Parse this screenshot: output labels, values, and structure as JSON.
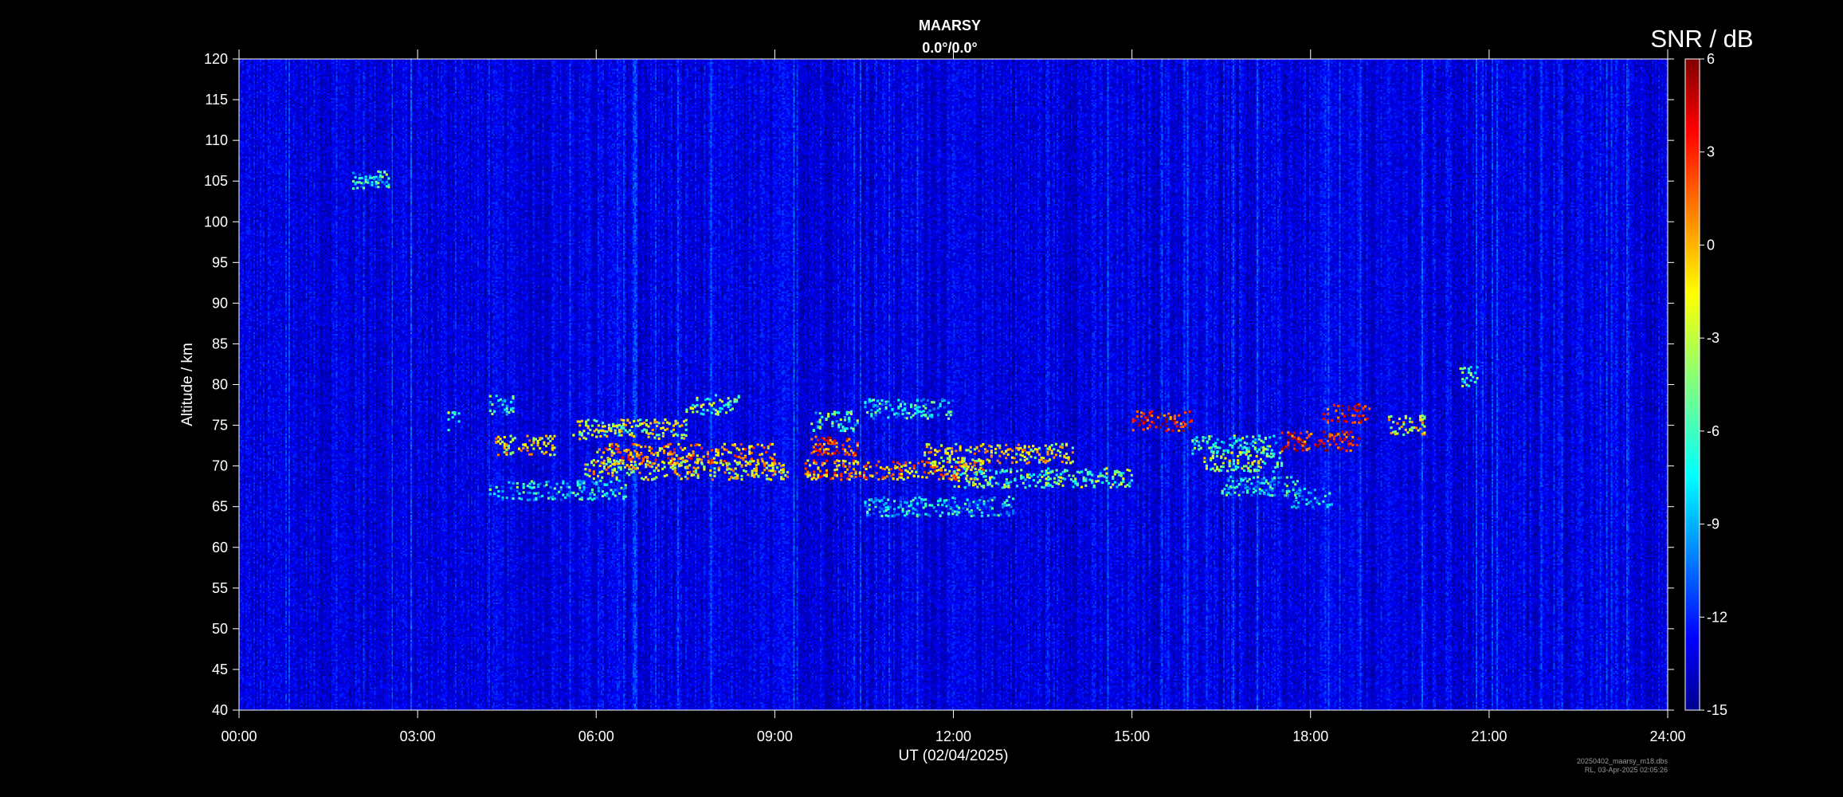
{
  "chart_data": {
    "type": "heatmap",
    "title": "MAARSY",
    "subtitle": "0.0°/0.0°",
    "xlabel": "UT (02/04/2025)",
    "ylabel": "Altitude / km",
    "xlim": [
      0,
      24
    ],
    "ylim": [
      40,
      120
    ],
    "x_ticks": [
      "00:00",
      "03:00",
      "06:00",
      "09:00",
      "12:00",
      "15:00",
      "18:00",
      "21:00",
      "24:00"
    ],
    "y_ticks": [
      40,
      45,
      50,
      55,
      60,
      65,
      70,
      75,
      80,
      85,
      90,
      95,
      100,
      105,
      110,
      115,
      120
    ],
    "colorbar": {
      "label": "SNR / dB",
      "range": [
        -15,
        6
      ],
      "ticks": [
        6,
        3,
        0,
        -3,
        -6,
        -9,
        -12,
        -15
      ],
      "colormap": "jet"
    },
    "background_snr_db": -13,
    "echo_layers": [
      {
        "t_start": 3.5,
        "t_end": 3.7,
        "alt": 75.5,
        "snr_db": -4
      },
      {
        "t_start": 4.2,
        "t_end": 4.6,
        "alt": 77.5,
        "snr_db": -7
      },
      {
        "t_start": 4.3,
        "t_end": 5.3,
        "alt": 72.5,
        "snr_db": -2
      },
      {
        "t_start": 4.2,
        "t_end": 6.5,
        "alt": 67.0,
        "snr_db": -7
      },
      {
        "t_start": 5.6,
        "t_end": 7.5,
        "alt": 74.5,
        "snr_db": -3
      },
      {
        "t_start": 6.0,
        "t_end": 9.0,
        "alt": 71.5,
        "snr_db": 0
      },
      {
        "t_start": 5.8,
        "t_end": 9.2,
        "alt": 69.5,
        "snr_db": -2
      },
      {
        "t_start": 7.5,
        "t_end": 8.4,
        "alt": 77.5,
        "snr_db": -5
      },
      {
        "t_start": 9.6,
        "t_end": 10.4,
        "alt": 75.5,
        "snr_db": -6
      },
      {
        "t_start": 9.6,
        "t_end": 10.4,
        "alt": 72.5,
        "snr_db": 2
      },
      {
        "t_start": 9.5,
        "t_end": 12.5,
        "alt": 69.5,
        "snr_db": 0
      },
      {
        "t_start": 10.5,
        "t_end": 12.0,
        "alt": 77.0,
        "snr_db": -7
      },
      {
        "t_start": 11.5,
        "t_end": 14.0,
        "alt": 71.5,
        "snr_db": -2
      },
      {
        "t_start": 10.5,
        "t_end": 13.0,
        "alt": 65.0,
        "snr_db": -8
      },
      {
        "t_start": 12.0,
        "t_end": 15.0,
        "alt": 68.5,
        "snr_db": -5
      },
      {
        "t_start": 15.0,
        "t_end": 16.0,
        "alt": 75.5,
        "snr_db": 3
      },
      {
        "t_start": 16.0,
        "t_end": 17.5,
        "alt": 72.5,
        "snr_db": -6
      },
      {
        "t_start": 16.2,
        "t_end": 17.5,
        "alt": 70.5,
        "snr_db": -4
      },
      {
        "t_start": 16.5,
        "t_end": 17.8,
        "alt": 67.5,
        "snr_db": -7
      },
      {
        "t_start": 17.5,
        "t_end": 18.8,
        "alt": 73.0,
        "snr_db": 3
      },
      {
        "t_start": 18.2,
        "t_end": 19.0,
        "alt": 76.5,
        "snr_db": 4
      },
      {
        "t_start": 19.3,
        "t_end": 19.9,
        "alt": 75.0,
        "snr_db": -2
      },
      {
        "t_start": 17.6,
        "t_end": 18.4,
        "alt": 66.0,
        "snr_db": -9
      },
      {
        "t_start": 20.5,
        "t_end": 20.8,
        "alt": 81.0,
        "snr_db": -6
      },
      {
        "t_start": 1.9,
        "t_end": 2.5,
        "alt": 105.0,
        "snr_db": -7
      }
    ]
  },
  "footer": {
    "file": "20250402_maarsy_m18.dbs",
    "stamp": "RL, 03-Apr-2025 02:05:26"
  }
}
